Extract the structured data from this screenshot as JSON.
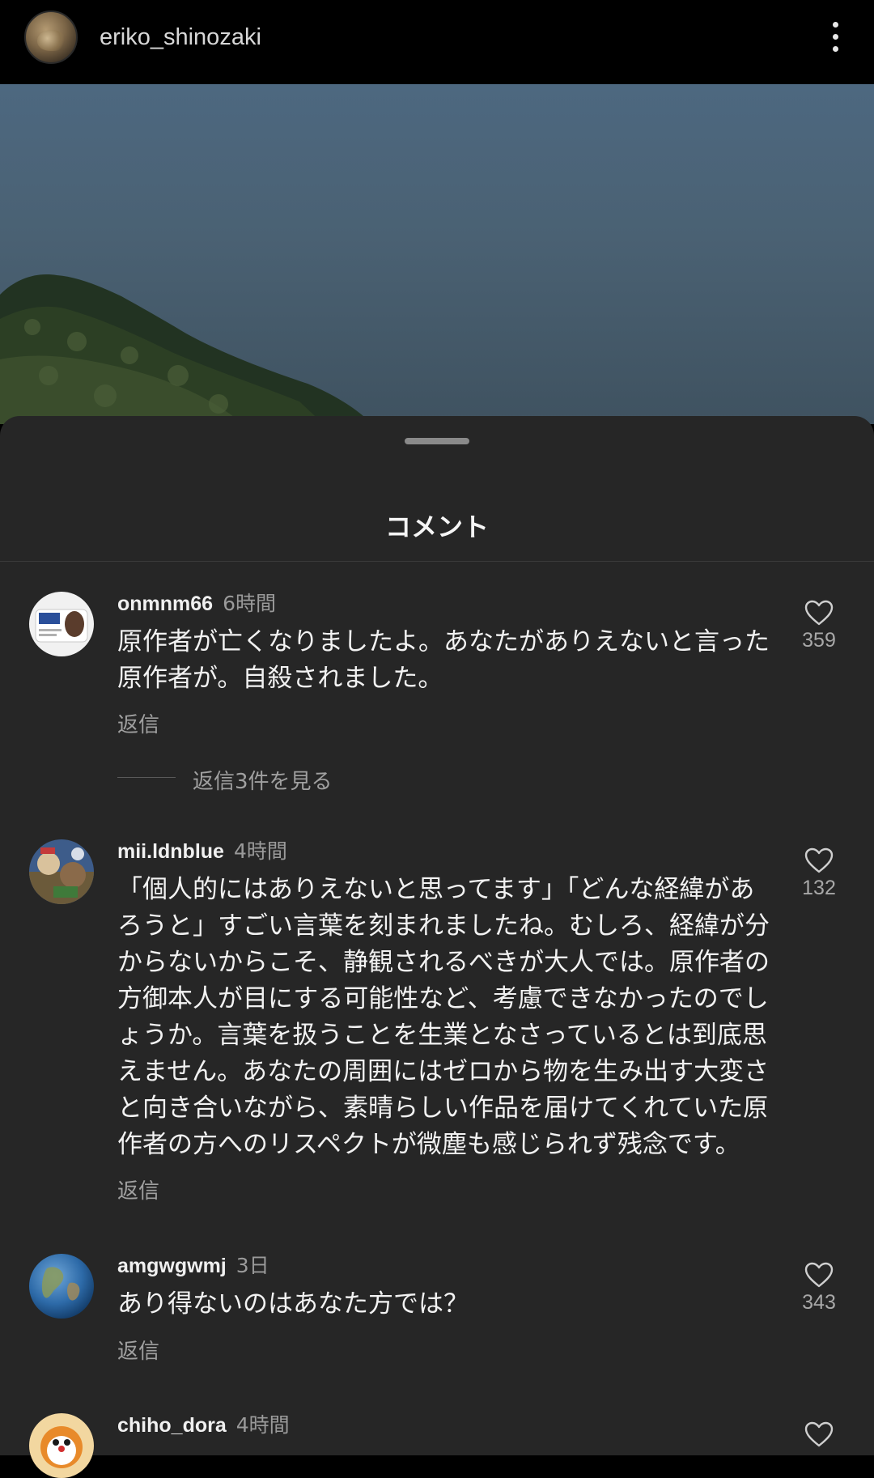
{
  "header": {
    "username": "eriko_shinozaki",
    "avatar_icon": "cat-avatar",
    "menu_icon": "more-vertical-icon"
  },
  "sheet": {
    "title": "コメント"
  },
  "comments": [
    {
      "username": "onmnm66",
      "time": "6時間",
      "lines": [
        "原作者が亡くなりましたよ。あなたがありえないと言った",
        "原作者が。自殺されました。"
      ],
      "reply_label": "返信",
      "like_count": "359",
      "view_replies": "返信3件を見る"
    },
    {
      "username": "mii.ldnblue",
      "time": "4時間",
      "lines": [
        "「個人的にはありえないと思ってます」「どんな経緯があ",
        "ろうと」すごい言葉を刻まれましたね。むしろ、経緯が分",
        "からないからこそ、静観されるべきが大人では。原作者の",
        "方御本人が目にする可能性など、考慮できなかったのでし",
        "ょうか。言葉を扱うことを生業となさっているとは到底思",
        "えません。あなたの周囲にはゼロから物を生み出す大変さ",
        "と向き合いながら、素晴らしい作品を届けてくれていた原",
        "作者の方へのリスペクトが微塵も感じられず残念です。"
      ],
      "reply_label": "返信",
      "like_count": "132"
    },
    {
      "username": "amgwgwmj",
      "time": "3日",
      "lines": [
        "あり得ないのはあなた方では？"
      ],
      "reply_label": "返信",
      "like_count": "343"
    },
    {
      "username": "chiho_dora",
      "time": "4時間",
      "lines": [],
      "reply_label": "",
      "like_count": ""
    }
  ],
  "colors": {
    "sheet_bg": "#262626",
    "text_primary": "#f2f2f2",
    "text_secondary": "#a0a0a0"
  }
}
